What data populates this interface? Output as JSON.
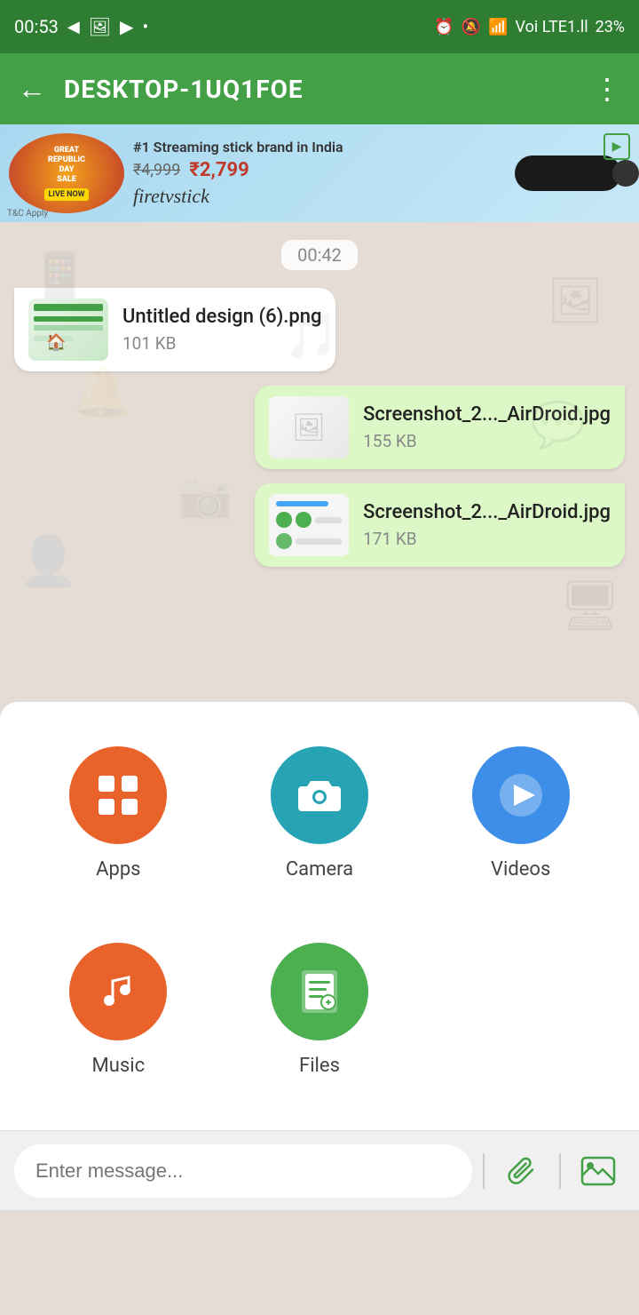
{
  "statusBar": {
    "time": "00:53",
    "batteryPercent": "23%"
  },
  "navBar": {
    "title": "DESKTOP-1UQ1FOE",
    "backLabel": "←",
    "moreLabel": "⋮"
  },
  "ad": {
    "leftText": "GREAT REPUBLIC DAY SALE LIVE NOW",
    "saleLabel": "GREAT\nREPUBLIC\nDAY\nSALE",
    "liveBadge": "LIVE NOW",
    "topText": "#1 Streaming stick brand in India",
    "oldPrice": "₹4,999",
    "newPrice": "₹2,799",
    "brand": "firetvstick",
    "tc": "T&C Apply"
  },
  "chat": {
    "timestamp": "00:42",
    "messages": [
      {
        "id": "msg1",
        "type": "received",
        "fileName": "Untitled design (6).png",
        "fileSize": "101 KB"
      },
      {
        "id": "msg2",
        "type": "sent",
        "fileName": "Screenshot_2..._AirDroid.jpg",
        "fileSize": "155 KB"
      },
      {
        "id": "msg3",
        "type": "sent",
        "fileName": "Screenshot_2..._AirDroid.jpg",
        "fileSize": "171 KB"
      }
    ]
  },
  "shareMenu": {
    "items": [
      {
        "id": "apps",
        "label": "Apps",
        "iconType": "apps",
        "colorClass": "share-icon-apps"
      },
      {
        "id": "camera",
        "label": "Camera",
        "iconType": "camera",
        "colorClass": "share-icon-camera"
      },
      {
        "id": "videos",
        "label": "Videos",
        "iconType": "videos",
        "colorClass": "share-icon-videos"
      },
      {
        "id": "music",
        "label": "Music",
        "iconType": "music",
        "colorClass": "share-icon-music"
      },
      {
        "id": "files",
        "label": "Files",
        "iconType": "files",
        "colorClass": "share-icon-files"
      }
    ]
  },
  "bottomBar": {
    "inputPlaceholder": "Enter message..."
  }
}
